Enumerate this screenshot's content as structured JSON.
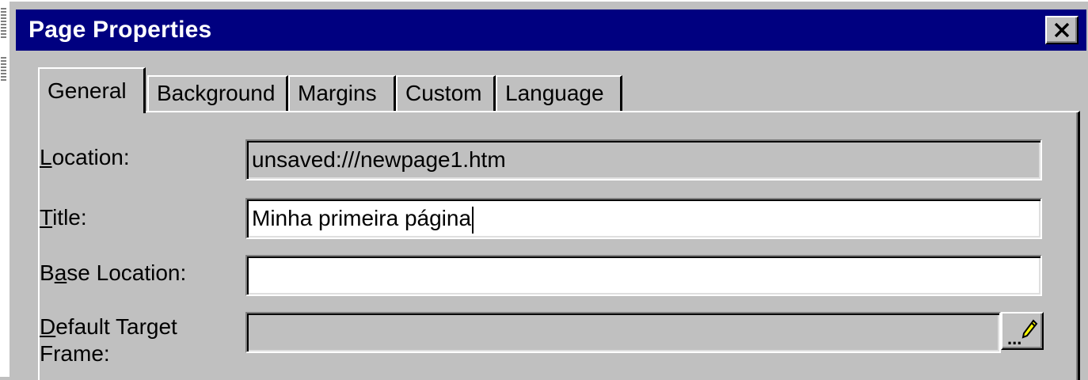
{
  "window": {
    "title": "Page Properties",
    "close_icon": "close-icon"
  },
  "tabs": [
    {
      "label": "General",
      "active": true
    },
    {
      "label": "Background",
      "active": false
    },
    {
      "label": "Margins",
      "active": false
    },
    {
      "label": "Custom",
      "active": false
    },
    {
      "label": "Language",
      "active": false
    }
  ],
  "fields": {
    "location": {
      "label_mnemonic": "L",
      "label_rest": "ocation:",
      "value": "unsaved:///newpage1.htm"
    },
    "title": {
      "label_mnemonic": "T",
      "label_rest": "itle:",
      "value": "Minha primeira página"
    },
    "base_location": {
      "label_pre": "B",
      "label_mnemonic": "a",
      "label_rest": "se Location:",
      "value": ""
    },
    "default_target_frame": {
      "label_mnemonic": "D",
      "label_rest": "efault Target",
      "label_line2": "Frame:",
      "value": ""
    }
  },
  "browse_button": {
    "label": "...",
    "icon": "pencil-icon"
  },
  "colors": {
    "titlebar": "#000080",
    "face": "#c0c0c0",
    "field_editable": "#ffffff"
  }
}
